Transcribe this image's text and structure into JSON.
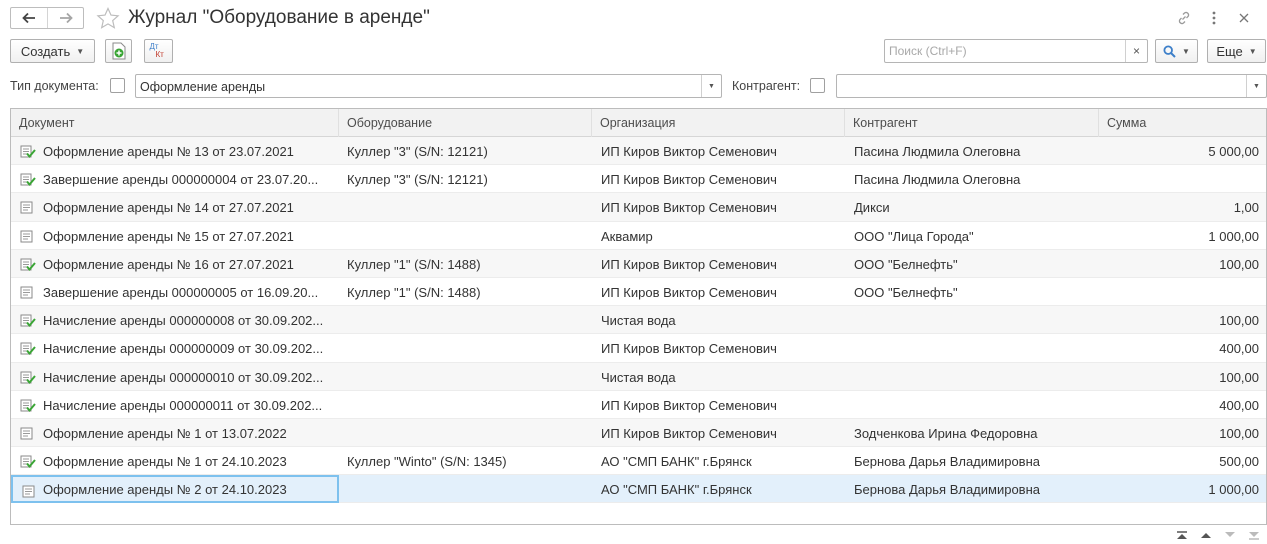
{
  "window": {
    "title": "Журнал \"Оборудование в аренде\""
  },
  "toolbar": {
    "create_label": "Создать",
    "dtkt_top": "Дт",
    "dtkt_bottom": "Кт",
    "search_placeholder": "Поиск (Ctrl+F)",
    "clear_glyph": "×",
    "more_label": "Еще"
  },
  "filters": {
    "doc_type_label": "Тип документа:",
    "doc_type_value": "Оформление аренды",
    "contractor_label": "Контрагент:",
    "contractor_value": ""
  },
  "table": {
    "columns": [
      "Документ",
      "Оборудование",
      "Организация",
      "Контрагент",
      "Сумма"
    ],
    "rows": [
      {
        "doc": "Оформление аренды № 13 от 23.07.2021",
        "equipment": "Куллер \"3\" (S/N: 12121)",
        "org": "ИП Киров Виктор Семенович",
        "contractor": "Пасина Людмила Олеговна",
        "sum": "5 000,00",
        "posted": true
      },
      {
        "doc": "Завершение аренды 000000004 от 23.07.20...",
        "equipment": "Куллер \"3\" (S/N: 12121)",
        "org": "ИП Киров Виктор Семенович",
        "contractor": "Пасина Людмила Олеговна",
        "sum": "",
        "posted": true
      },
      {
        "doc": "Оформление аренды № 14 от 27.07.2021",
        "equipment": "",
        "org": "ИП Киров Виктор Семенович",
        "contractor": "Дикси",
        "sum": "1,00",
        "posted": false
      },
      {
        "doc": "Оформление аренды № 15 от 27.07.2021",
        "equipment": "",
        "org": "Аквамир",
        "contractor": "ООО \"Лица Города\"",
        "sum": "1 000,00",
        "posted": false
      },
      {
        "doc": "Оформление аренды № 16 от 27.07.2021",
        "equipment": "Куллер \"1\" (S/N: 1488)",
        "org": "ИП Киров Виктор Семенович",
        "contractor": "ООО \"Белнефть\"",
        "sum": "100,00",
        "posted": true
      },
      {
        "doc": "Завершение аренды 000000005 от 16.09.20...",
        "equipment": "Куллер \"1\" (S/N: 1488)",
        "org": "ИП Киров Виктор Семенович",
        "contractor": "ООО \"Белнефть\"",
        "sum": "",
        "posted": false
      },
      {
        "doc": "Начисление аренды 000000008 от 30.09.202...",
        "equipment": "",
        "org": "Чистая вода",
        "contractor": "",
        "sum": "100,00",
        "posted": true
      },
      {
        "doc": "Начисление аренды 000000009 от 30.09.202...",
        "equipment": "",
        "org": "ИП Киров Виктор Семенович",
        "contractor": "",
        "sum": "400,00",
        "posted": true
      },
      {
        "doc": "Начисление аренды 000000010 от 30.09.202...",
        "equipment": "",
        "org": "Чистая вода",
        "contractor": "",
        "sum": "100,00",
        "posted": true
      },
      {
        "doc": "Начисление аренды 000000011 от 30.09.202...",
        "equipment": "",
        "org": "ИП Киров Виктор Семенович",
        "contractor": "",
        "sum": "400,00",
        "posted": true
      },
      {
        "doc": "Оформление аренды № 1 от 13.07.2022",
        "equipment": "",
        "org": "ИП Киров Виктор Семенович",
        "contractor": "Зодченкова Ирина Федоровна",
        "sum": "100,00",
        "posted": false
      },
      {
        "doc": "Оформление аренды № 1 от 24.10.2023",
        "equipment": "Куллер \"Winto\" (S/N: 1345)",
        "org": "АО \"СМП БАНК\" г.Брянск",
        "contractor": "Бернова Дарья Владимировна",
        "sum": "500,00",
        "posted": true
      },
      {
        "doc": "Оформление аренды № 2 от 24.10.2023",
        "equipment": "",
        "org": "АО \"СМП БАНК\" г.Брянск",
        "contractor": "Бернова Дарья Владимировна",
        "sum": "1 000,00",
        "posted": false,
        "selected": true
      }
    ]
  },
  "colors": {
    "accent_blue": "#3d7fc9",
    "posted_green": "#3aa535",
    "selection": "#e3f0fb",
    "selection_border": "#7dc1ee"
  },
  "icons": [
    "back-arrow-icon",
    "forward-arrow-icon",
    "favorite-star-icon",
    "link-icon",
    "more-vertical-icon",
    "close-icon",
    "add-copy-icon",
    "dt-kt-icon",
    "search-icon",
    "document-posted-icon",
    "document-icon",
    "scroll-first-icon",
    "scroll-up-icon",
    "scroll-down-icon",
    "scroll-last-icon"
  ]
}
